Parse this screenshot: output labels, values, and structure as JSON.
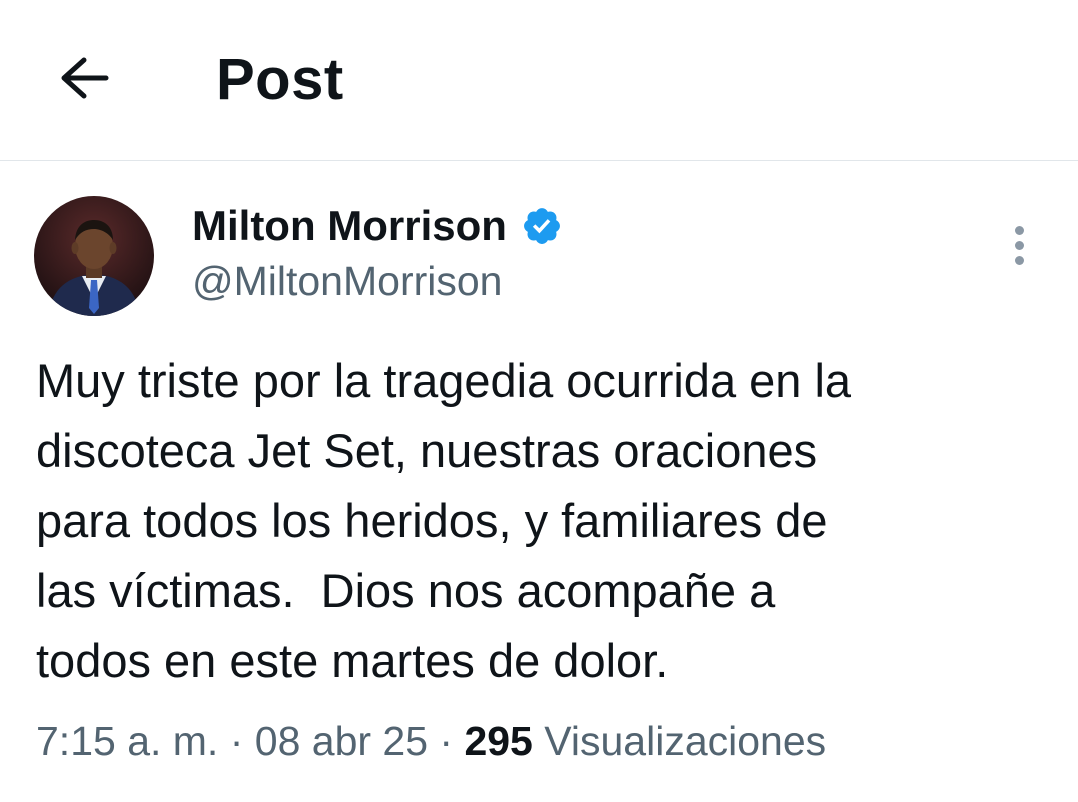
{
  "header": {
    "title": "Post"
  },
  "icons": {
    "back": "arrow-left-icon",
    "verified": "verified-badge-icon",
    "more": "more-vertical-icon"
  },
  "colors": {
    "verified": "#1d9bf0",
    "secondary_text": "#536471",
    "primary_text": "#0f1419"
  },
  "author": {
    "name": "Milton Morrison",
    "handle": "@MiltonMorrison",
    "verified": true
  },
  "tweet": {
    "lines": [
      "Muy triste por la tragedia ocurrida en la",
      "discoteca Jet Set, nuestras oraciones",
      "para todos los heridos, y familiares de",
      "las víctimas.  Dios nos acompañe a",
      "todos en este martes de dolor."
    ]
  },
  "meta": {
    "time": "7:15 a. m.",
    "separator": " · ",
    "date": "08 abr 25",
    "views_count": "295",
    "views_label": "Visualizaciones"
  }
}
